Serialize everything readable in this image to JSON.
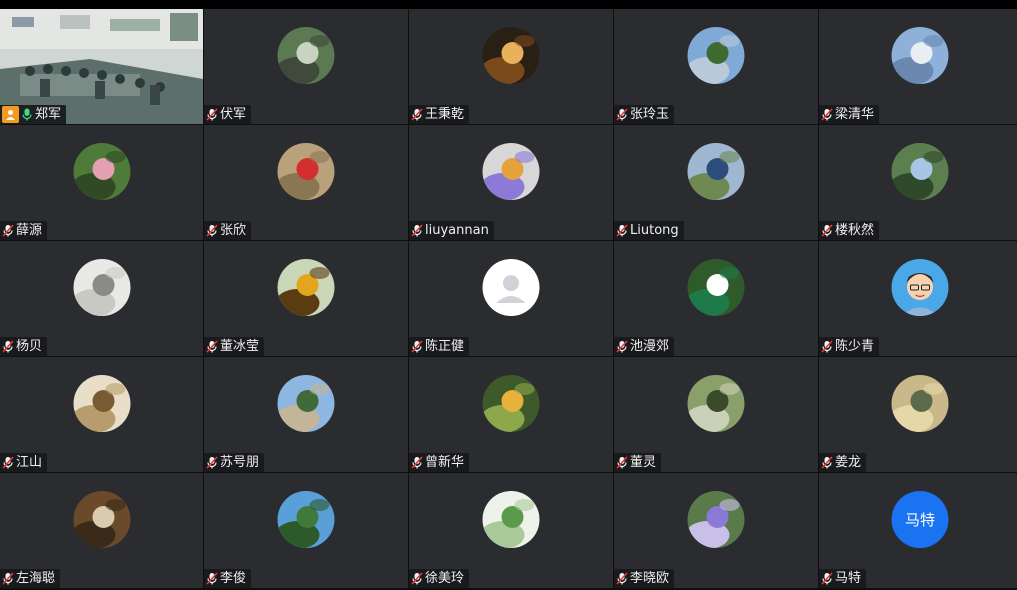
{
  "participants": [
    {
      "name": "郑军",
      "kind": "video",
      "mic": "active",
      "host": true
    },
    {
      "name": "伏军",
      "kind": "photo",
      "mic": "muted",
      "bg": "#5b7a52",
      "fg": "#c8d3c2",
      "accent": "#3f4a3b"
    },
    {
      "name": "王秉乾",
      "kind": "photo",
      "mic": "muted",
      "bg": "#2a1f14",
      "fg": "#e7b25a",
      "accent": "#7a4a1c"
    },
    {
      "name": "张玲玉",
      "kind": "photo",
      "mic": "muted",
      "bg": "#7fa9d6",
      "fg": "#3d6b2f",
      "accent": "#b8c9d9"
    },
    {
      "name": "梁清华",
      "kind": "photo",
      "mic": "muted",
      "bg": "#8fb0d8",
      "fg": "#e9eef5",
      "accent": "#6a88b0"
    },
    {
      "name": "薛源",
      "kind": "photo",
      "mic": "muted",
      "bg": "#4e7a3a",
      "fg": "#e59fb3",
      "accent": "#2f4a24"
    },
    {
      "name": "张欣",
      "kind": "photo",
      "mic": "muted",
      "bg": "#b9a27b",
      "fg": "#d32f2f",
      "accent": "#8a7653"
    },
    {
      "name": "liuyannan",
      "kind": "photo",
      "mic": "muted",
      "bg": "#d7d7d7",
      "fg": "#e6a23c",
      "accent": "#8c7ad6"
    },
    {
      "name": "Liutong",
      "kind": "photo",
      "mic": "muted",
      "bg": "#9fb7d1",
      "fg": "#2c4d7a",
      "accent": "#6e8a52"
    },
    {
      "name": "楼秋然",
      "kind": "photo",
      "mic": "muted",
      "bg": "#5b7f4f",
      "fg": "#a7c6e6",
      "accent": "#2f4a2a"
    },
    {
      "name": "杨贝",
      "kind": "photo",
      "mic": "muted",
      "bg": "#e8e8e6",
      "fg": "#8a8a86",
      "accent": "#c9c9c4"
    },
    {
      "name": "董冰莹",
      "kind": "photo",
      "mic": "muted",
      "bg": "#c9d6b8",
      "fg": "#e2a51c",
      "accent": "#5a3b12"
    },
    {
      "name": "陈正健",
      "kind": "default",
      "mic": "muted"
    },
    {
      "name": "池漫郊",
      "kind": "photo",
      "mic": "muted",
      "bg": "#2f5a2a",
      "fg": "#ffffff",
      "accent": "#1f7a4a"
    },
    {
      "name": "陈少青",
      "kind": "cartoon",
      "mic": "muted"
    },
    {
      "name": "江山",
      "kind": "photo",
      "mic": "muted",
      "bg": "#e9dfc8",
      "fg": "#7a5a32",
      "accent": "#b79d6d"
    },
    {
      "name": "苏号朋",
      "kind": "photo",
      "mic": "muted",
      "bg": "#8db7e0",
      "fg": "#3f6a3a",
      "accent": "#c2b59a"
    },
    {
      "name": "曾新华",
      "kind": "photo",
      "mic": "muted",
      "bg": "#3f5a2a",
      "fg": "#e8b23a",
      "accent": "#8da84a"
    },
    {
      "name": "董灵",
      "kind": "photo",
      "mic": "muted",
      "bg": "#8aa06a",
      "fg": "#3a4a2a",
      "accent": "#c9d1b8"
    },
    {
      "name": "姜龙",
      "kind": "photo",
      "mic": "muted",
      "bg": "#c9b98a",
      "fg": "#5a6a4a",
      "accent": "#e6d7a8"
    },
    {
      "name": "左海聪",
      "kind": "photo",
      "mic": "muted",
      "bg": "#6a4a2a",
      "fg": "#d9cbb0",
      "accent": "#3a2a1a"
    },
    {
      "name": "李俊",
      "kind": "photo",
      "mic": "muted",
      "bg": "#5aa0d8",
      "fg": "#3f7a3a",
      "accent": "#2c5a2a"
    },
    {
      "name": "徐美玲",
      "kind": "photo",
      "mic": "muted",
      "bg": "#eef2ea",
      "fg": "#5a9a4a",
      "accent": "#a8c998"
    },
    {
      "name": "李晓欧",
      "kind": "photo",
      "mic": "muted",
      "bg": "#5a7a4a",
      "fg": "#8a7ad6",
      "accent": "#c9c0ea"
    },
    {
      "name": "马特",
      "kind": "text",
      "mic": "muted",
      "initials": "马特"
    }
  ]
}
